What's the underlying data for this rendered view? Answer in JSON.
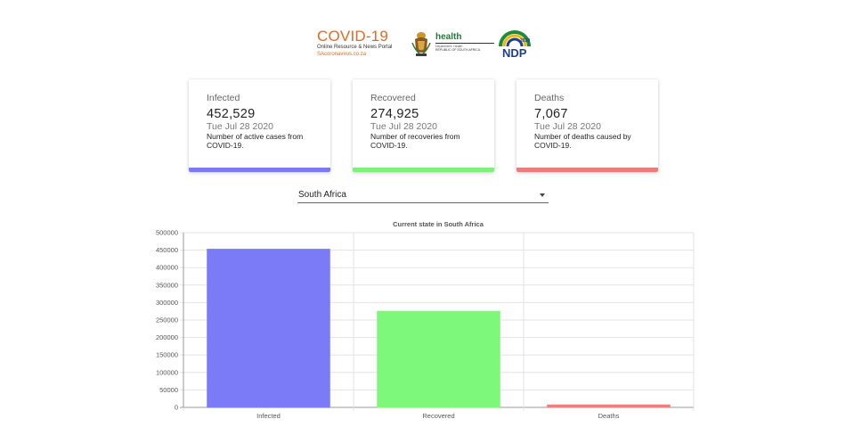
{
  "header": {
    "covid_title": "COVID-19",
    "covid_subtitle": "Online Resource & News Portal",
    "covid_url": "SAcoronavirus.co.za",
    "health_word": "health",
    "health_dept": "Department: Health",
    "health_country": "REPUBLIC OF SOUTH AFRICA",
    "ndp_year": "2030",
    "ndp_label": "NDP"
  },
  "cards": [
    {
      "title": "Infected",
      "value": "452,529",
      "date": "Tue Jul 28 2020",
      "description": "Number of active cases from COVID-19.",
      "color": "#7b79f5"
    },
    {
      "title": "Recovered",
      "value": "274,925",
      "date": "Tue Jul 28 2020",
      "description": "Number of recoveries from COVID-19.",
      "color": "#7ff07c"
    },
    {
      "title": "Deaths",
      "value": "7,067",
      "date": "Tue Jul 28 2020",
      "description": "Number of deaths caused by COVID-19.",
      "color": "#ec7e7a"
    }
  ],
  "country_select": {
    "value": "South Africa"
  },
  "chart_data": {
    "type": "bar",
    "title": "Current state in South Africa",
    "categories": [
      "Infected",
      "Recovered",
      "Deaths"
    ],
    "values": [
      452529,
      274925,
      7067
    ],
    "colors": [
      "#7b7bf7",
      "#7df87a",
      "#ef7f7b"
    ],
    "ylim": [
      0,
      500000
    ],
    "yticks": [
      0,
      50000,
      100000,
      150000,
      200000,
      250000,
      300000,
      350000,
      400000,
      450000,
      500000
    ],
    "grid": true,
    "xlabel": "",
    "ylabel": ""
  }
}
